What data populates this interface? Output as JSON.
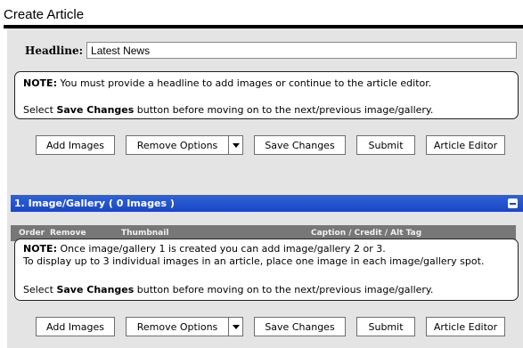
{
  "page": {
    "title": "Create Article"
  },
  "headline": {
    "label": "Headline:",
    "value": "Latest News"
  },
  "note_top": {
    "line1_bold": "NOTE:",
    "line1_text": " You must provide a headline to add images or continue to the article editor.",
    "line2_pre": "Select ",
    "line2_bold": "Save Changes",
    "line2_post": " button before moving on to the next/previous image/gallery."
  },
  "buttons_top": {
    "add_images": "Add Images",
    "remove_options": "Remove Options",
    "save_changes": "Save Changes",
    "submit": "Submit",
    "article_editor": "Article Editor"
  },
  "gallery": {
    "title": "1. Image/Gallery ( 0 Images )",
    "columns": {
      "order": "Order",
      "remove": "Remove",
      "thumbnail": "Thumbnail",
      "caption": "Caption / Credit / Alt Tag"
    }
  },
  "note_bottom": {
    "line1_bold": "NOTE:",
    "line1_text": " Once image/gallery 1 is created you can add image/gallery 2 or 3.",
    "line2_text": "To display up to 3 individual images in an article, place one image in each image/gallery spot.",
    "line3_pre": "Select ",
    "line3_bold": "Save Changes",
    "line3_post": " button before moving on to the next/previous image/gallery."
  },
  "buttons_bottom": {
    "add_images": "Add Images",
    "remove_options": "Remove Options",
    "save_changes": "Save Changes",
    "submit": "Submit",
    "article_editor": "Article Editor"
  },
  "colors": {
    "gallery_bar": "#1c46c4",
    "column_header": "#777777",
    "panel_bg": "#e4e4e4"
  },
  "icons": {
    "collapse": "minus-icon",
    "dropdown": "caret-down-icon"
  }
}
